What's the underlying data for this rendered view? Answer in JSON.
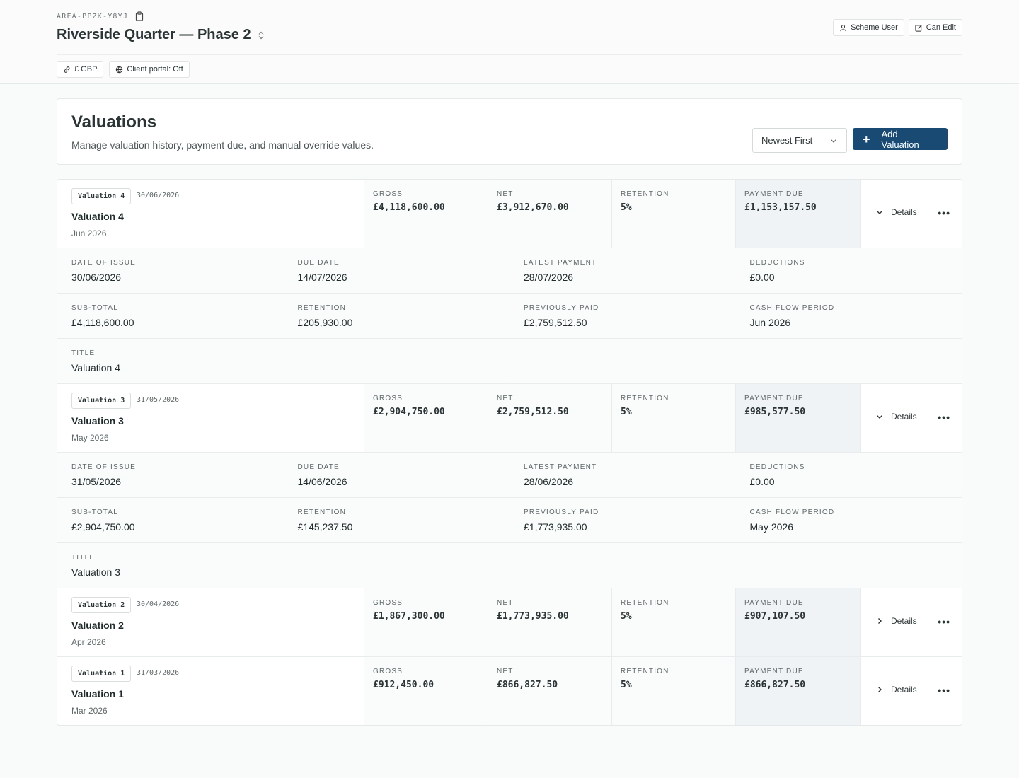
{
  "header": {
    "area_code": "AREA-PPZK-Y8YJ",
    "project_title": "Riverside Quarter — Phase 2",
    "role_user": "Scheme User",
    "role_edit": "Can Edit",
    "currency": "£ GBP",
    "client_portal": "Client portal: Off"
  },
  "valuations": {
    "heading": "Valuations",
    "description": "Manage valuation history, payment due, and manual override values.",
    "sort_value": "Newest First",
    "add_label": "Add Valuation"
  },
  "labels": {
    "gross": "GROSS",
    "net": "NET",
    "retention": "RETENTION",
    "payment_due": "PAYMENT DUE",
    "details": "Details",
    "date_of_issue": "DATE OF ISSUE",
    "due_date": "DUE DATE",
    "latest_payment": "LATEST PAYMENT",
    "deductions": "DEDUCTIONS",
    "sub_total": "SUB-TOTAL",
    "retention_amount": "RETENTION",
    "previously_paid": "PREVIOUSLY PAID",
    "cash_flow_period": "CASH FLOW PERIOD",
    "title": "TITLE"
  },
  "items": [
    {
      "badge": "Valuation 4",
      "date": "30/06/2026",
      "title": "Valuation 4",
      "period": "Jun 2026",
      "gross": "£4,118,600.00",
      "net": "£3,912,670.00",
      "retention": "5%",
      "payment_due": "£1,153,157.50",
      "expanded": true,
      "date_of_issue": "30/06/2026",
      "due_date": "14/07/2026",
      "latest_payment": "28/07/2026",
      "deductions": "£0.00",
      "sub_total": "£4,118,600.00",
      "retention_amount": "£205,930.00",
      "previously_paid": "£2,759,512.50",
      "cash_flow_period": "Jun 2026",
      "detail_title": "Valuation 4"
    },
    {
      "badge": "Valuation 3",
      "date": "31/05/2026",
      "title": "Valuation 3",
      "period": "May 2026",
      "gross": "£2,904,750.00",
      "net": "£2,759,512.50",
      "retention": "5%",
      "payment_due": "£985,577.50",
      "expanded": true,
      "date_of_issue": "31/05/2026",
      "due_date": "14/06/2026",
      "latest_payment": "28/06/2026",
      "deductions": "£0.00",
      "sub_total": "£2,904,750.00",
      "retention_amount": "£145,237.50",
      "previously_paid": "£1,773,935.00",
      "cash_flow_period": "May 2026",
      "detail_title": "Valuation 3"
    },
    {
      "badge": "Valuation 2",
      "date": "30/04/2026",
      "title": "Valuation 2",
      "period": "Apr 2026",
      "gross": "£1,867,300.00",
      "net": "£1,773,935.00",
      "retention": "5%",
      "payment_due": "£907,107.50",
      "expanded": false
    },
    {
      "badge": "Valuation 1",
      "date": "31/03/2026",
      "title": "Valuation 1",
      "period": "Mar 2026",
      "gross": "£912,450.00",
      "net": "£866,827.50",
      "retention": "5%",
      "payment_due": "£866,827.50",
      "expanded": false
    }
  ],
  "icons": {
    "clipboard": "clipboard-icon",
    "sort": "sort-caret-icon",
    "user": "user-icon",
    "edit": "edit-icon",
    "link": "link-icon",
    "globe": "globe-icon",
    "chevron_down": "chevron-down-icon",
    "chevron_right": "chevron-right-icon",
    "more": "more-icon",
    "plus": "plus-icon"
  },
  "colors": {
    "primary": "#184a74",
    "due_bg": "#f0f3f6"
  }
}
